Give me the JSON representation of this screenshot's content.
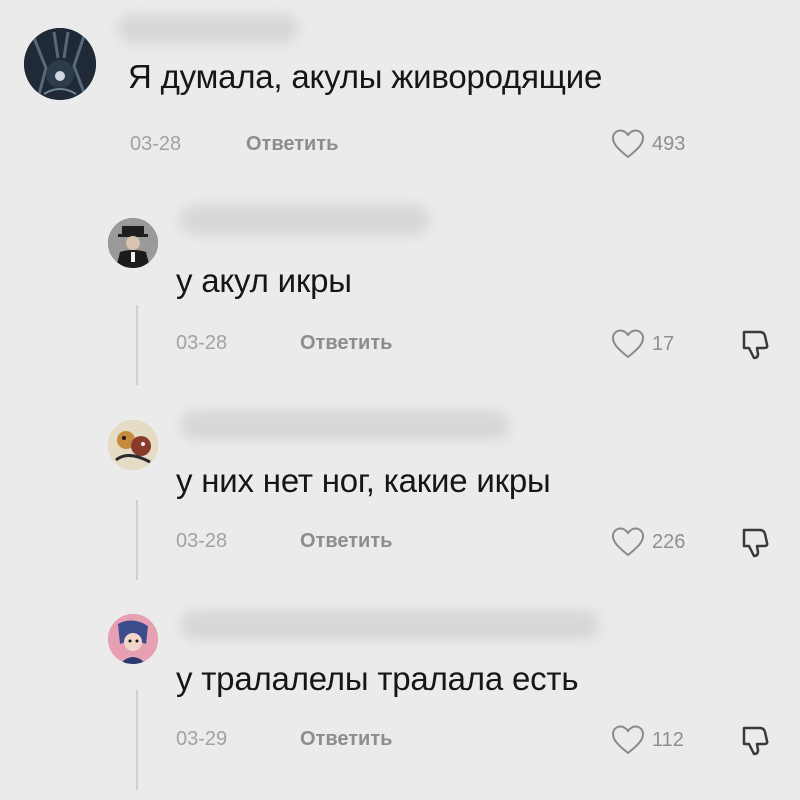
{
  "comments": [
    {
      "text": "Я думала, акулы живородящие",
      "date": "03-28",
      "reply_label": "Ответить",
      "likes": "493",
      "avatar_icon": "dark-figure-avatar"
    },
    {
      "text": "у акул икры",
      "date": "03-28",
      "reply_label": "Ответить",
      "likes": "17",
      "avatar_icon": "man-in-hat-avatar"
    },
    {
      "text": "у них нет ног, какие икры",
      "date": "03-28",
      "reply_label": "Ответить",
      "likes": "226",
      "avatar_icon": "cartoon-character-avatar"
    },
    {
      "text": "у тралалелы тралала есть",
      "date": "03-29",
      "reply_label": "Ответить",
      "likes": "112",
      "avatar_icon": "anime-character-avatar"
    }
  ],
  "colors": {
    "background": "#ebebeb",
    "text": "#161616",
    "meta": "#a2a2a2",
    "icon_stroke": "#8a8a8a"
  }
}
